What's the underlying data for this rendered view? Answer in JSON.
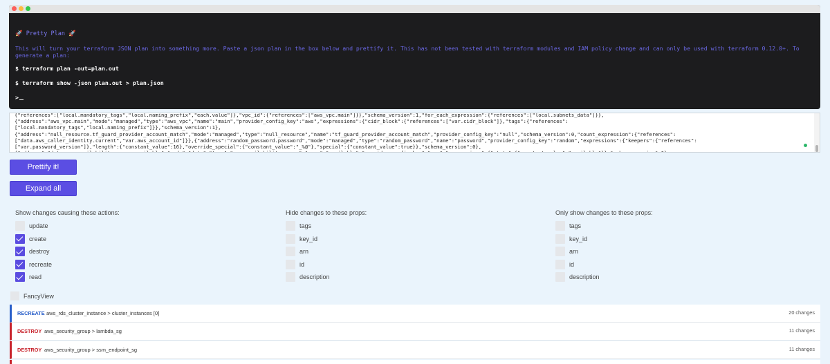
{
  "terminal": {
    "title": "🚀 Pretty Plan 🚀",
    "description": "This will turn your terraform JSON plan into something more. Paste a json plan in the box below and prettify it. This has not been tested with terraform modules and IAM policy change and can only be used with terraform 0.12.0+. To generate a plan:",
    "commands": [
      "$ terraform plan -out=plan.out",
      "$ terraform show -json plan.out > plan.json",
      ">"
    ]
  },
  "json_input": {
    "value": "{\"references\":[\"local.mandatory_tags\",\"local.naming_prefix\",\"each.value\"]},\"vpc_id\":{\"references\":[\"aws_vpc.main\"]}},\"schema_version\":1,\"for_each_expression\":{\"references\":[\"local.subnets_data\"]}},\n{\"address\":\"aws_vpc.main\",\"mode\":\"managed\",\"type\":\"aws_vpc\",\"name\":\"main\",\"provider_config_key\":\"aws\",\"expressions\":{\"cidr_block\":{\"references\":[\"var.cidr_block\"]},\"tags\":{\"references\":\n[\"local.mandatory_tags\",\"local.naming_prefix\"]}},\"schema_version\":1},\n{\"address\":\"null_resource.tf_guard_provider_account_match\",\"mode\":\"managed\",\"type\":\"null_resource\",\"name\":\"tf_guard_provider_account_match\",\"provider_config_key\":\"null\",\"schema_version\":0,\"count_expression\":{\"references\":\n[\"data.aws_caller_identity.current\",\"var.aws_account_id\"]}},{\"address\":\"random_password.password\",\"mode\":\"managed\",\"type\":\"random_password\",\"name\":\"password\",\"provider_config_key\":\"random\",\"expressions\":{\"keepers\":{\"references\":\n[\"var.password_version\"]},\"length\":{\"constant_value\":16},\"override_special\":{\"constant_value\":\"_%@\"},\"special\":{\"constant_value\":true}},\"schema_version\":0},\n{\"address\":\"data.aws_availability_zones.available\",\"mode\":\"data\",\"type\":\"aws_availability_zones\",\"name\":\"available\",\"provider_config_key\":\"aws\",\"expressions\":{\"state\":{\"constant_value\":\"available\"}},\"schema_version\":0},"
  },
  "buttons": {
    "prettify": "Prettify it!",
    "expand": "Expand all"
  },
  "filters": {
    "actions": {
      "title": "Show changes causing these actions:",
      "options": [
        {
          "label": "update",
          "checked": false
        },
        {
          "label": "create",
          "checked": true
        },
        {
          "label": "destroy",
          "checked": true
        },
        {
          "label": "recreate",
          "checked": true
        },
        {
          "label": "read",
          "checked": true
        }
      ]
    },
    "hide_props": {
      "title": "Hide changes to these props:",
      "options": [
        {
          "label": "tags",
          "checked": false
        },
        {
          "label": "key_id",
          "checked": false
        },
        {
          "label": "arn",
          "checked": false
        },
        {
          "label": "id",
          "checked": false
        },
        {
          "label": "description",
          "checked": false
        }
      ]
    },
    "only_props": {
      "title": "Only show changes to these props:",
      "options": [
        {
          "label": "tags",
          "checked": false
        },
        {
          "label": "key_id",
          "checked": false
        },
        {
          "label": "arn",
          "checked": false
        },
        {
          "label": "id",
          "checked": false
        },
        {
          "label": "description",
          "checked": false
        }
      ]
    }
  },
  "fancy_view": {
    "label": "FancyView",
    "checked": false
  },
  "changes": [
    {
      "action": "RECREATE",
      "resource": "aws_rds_cluster_instance > cluster_instances [0]",
      "count": "20 changes"
    },
    {
      "action": "DESTROY",
      "resource": "aws_security_group > lambda_sg",
      "count": "11 changes"
    },
    {
      "action": "DESTROY",
      "resource": "aws_security_group > ssm_endpoint_sg",
      "count": "11 changes"
    },
    {
      "action": "",
      "resource": "",
      "count": ""
    }
  ],
  "colors": {
    "accent": "#5b4ee3",
    "recreate": "#2a5fc9",
    "destroy": "#c8232c",
    "background": "#eaf4fc",
    "terminal": "#1c1c1e"
  }
}
